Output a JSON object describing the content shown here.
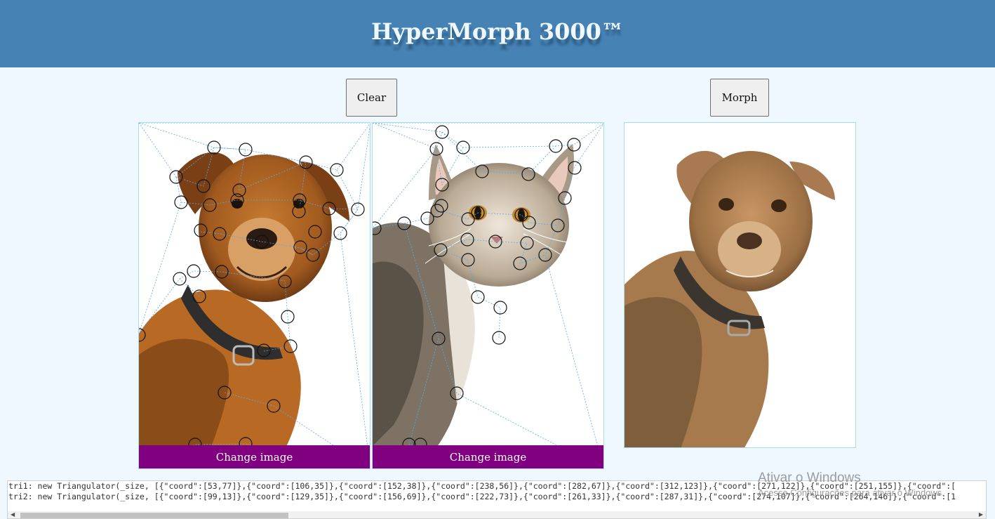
{
  "app": {
    "title": "HyperMorph 3000™"
  },
  "toolbar": {
    "clear_label": "Clear",
    "morph_label": "Morph"
  },
  "panels": {
    "left": {
      "change_label": "Change image",
      "subject": "dog"
    },
    "right": {
      "change_label": "Change image",
      "subject": "cat"
    },
    "result": {
      "subject": "morphed dog-cat"
    }
  },
  "console": {
    "tri1": "tri1: new Triangulator(_size, [{\"coord\":[53,77]},{\"coord\":[106,35]},{\"coord\":[152,38]},{\"coord\":[238,56]},{\"coord\":[282,67]},{\"coord\":[312,123]},{\"coord\":[271,122]},{\"coord\":[251,155]},{\"coord\":[",
    "tri2": "tri2: new Triangulator(_size, [{\"coord\":[99,13]},{\"coord\":[129,35]},{\"coord\":[156,69]},{\"coord\":[222,73]},{\"coord\":[261,33]},{\"coord\":[287,31]},{\"coord\":[274,107]},{\"coord\":[264,146]},{\"coord\":[1"
  },
  "watermark": {
    "line1": "Ativar o Windows",
    "line2": "Acesse Configurações para ativar o Windows."
  },
  "colors": {
    "header": "#4682b4",
    "background": "#f0f8ff",
    "change_button": "#800080",
    "mesh": "#5aa9e6"
  }
}
